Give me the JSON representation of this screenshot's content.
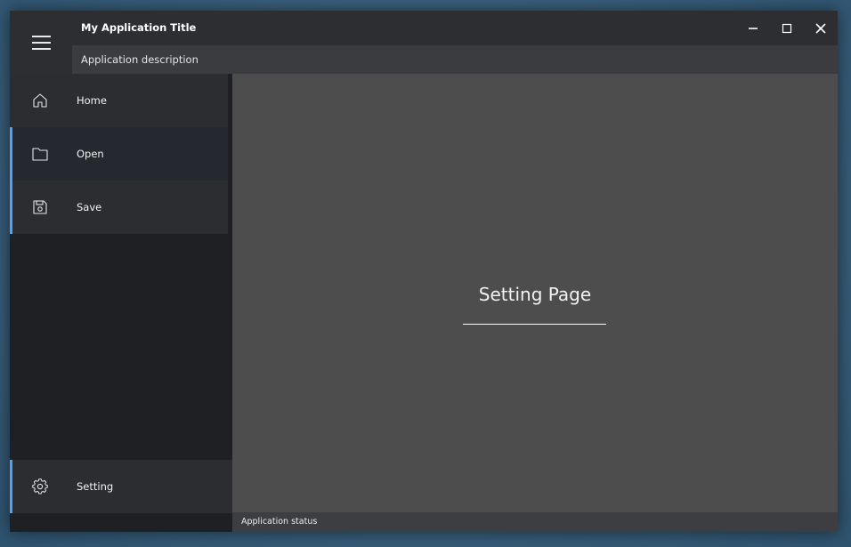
{
  "app": {
    "title": "My Application Title",
    "description": "Application description",
    "status": "Application status"
  },
  "sidebar": {
    "items": [
      {
        "label": "Home",
        "icon": "home-icon"
      },
      {
        "label": "Open",
        "icon": "folder-icon"
      },
      {
        "label": "Save",
        "icon": "save-icon"
      }
    ],
    "footer_item": {
      "label": "Setting",
      "icon": "gear-icon"
    }
  },
  "page": {
    "title": "Setting Page"
  },
  "colors": {
    "accent": "#4da3f2",
    "sidebar_bg": "#1f2024",
    "content_bg": "#4d4d4d"
  }
}
